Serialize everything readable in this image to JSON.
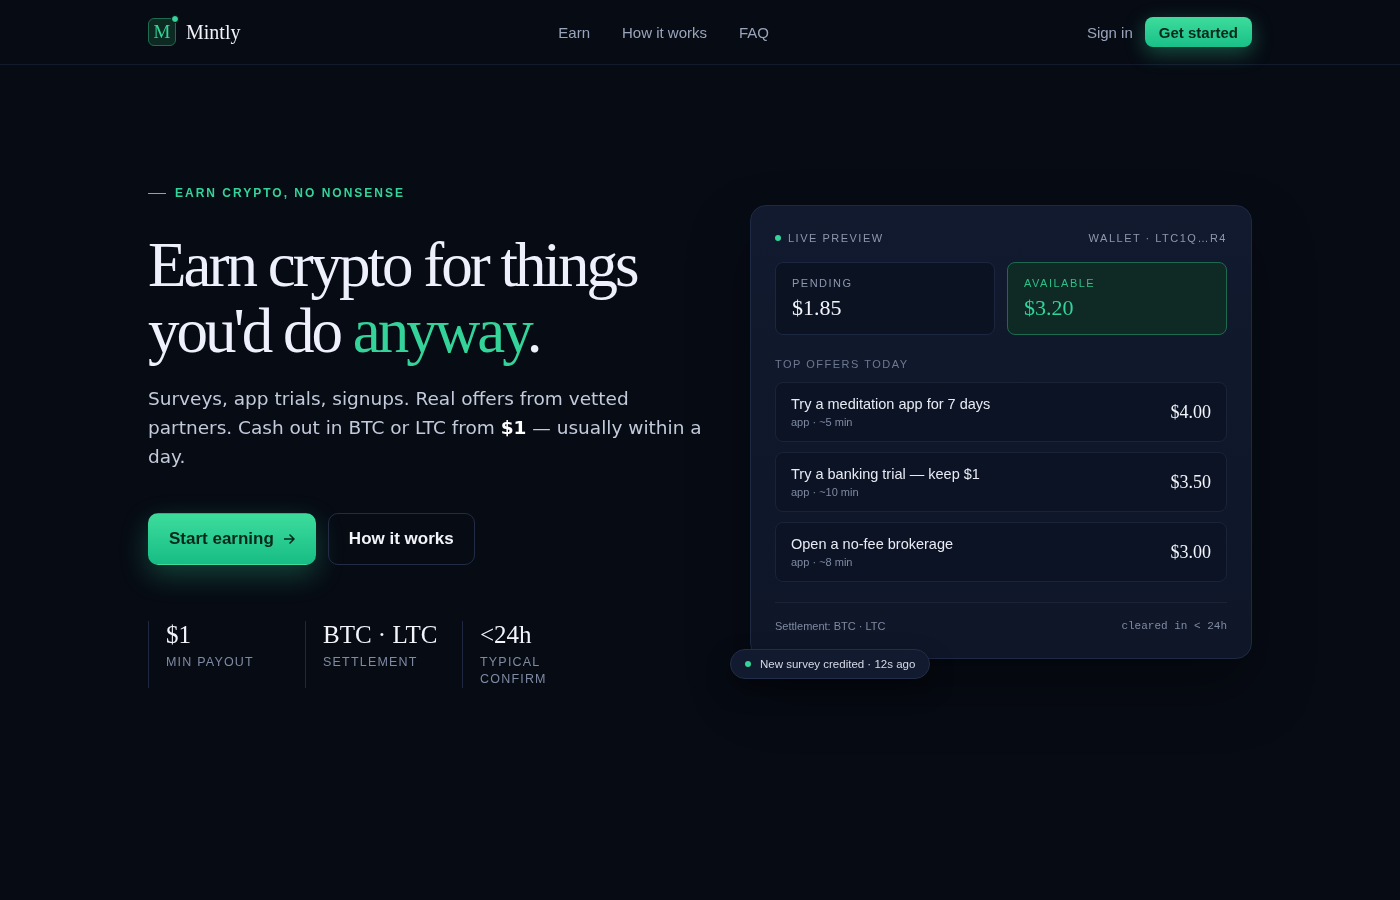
{
  "header": {
    "logo": {
      "mark": "M",
      "name": "Mintly"
    },
    "nav": [
      {
        "label": "Earn"
      },
      {
        "label": "How it works"
      },
      {
        "label": "FAQ"
      }
    ],
    "sign_in": "Sign in",
    "cta": "Get started"
  },
  "hero": {
    "eyebrow": "EARN CRYPTO, NO NONSENSE",
    "headline": {
      "lead": "Earn crypto for things you'd do",
      "accent": "anyway",
      "tail": "."
    },
    "intro": "Surveys, app trials, signups. Real offers from vetted partners. Cash out in BTC or LTC from **$1** — usually within a day.",
    "buttons": [
      {
        "label": "Start earning",
        "kind": "primary"
      },
      {
        "label": "How it works",
        "kind": "secondary"
      }
    ],
    "stats": [
      {
        "value": "$1",
        "label": "MIN PAYOUT"
      },
      {
        "value": "BTC · LTC",
        "label": "SETTLEMENT"
      },
      {
        "value": "<24h",
        "label": "TYPICAL CONFIRM"
      }
    ]
  },
  "preview": {
    "live_label": "LIVE PREVIEW",
    "wallet": "WALLET · LTC1Q…R4",
    "balances": [
      {
        "label": "PENDING",
        "amount": "$1.85",
        "highlighted": false
      },
      {
        "label": "AVAILABLE",
        "amount": "$3.20",
        "highlighted": true
      }
    ],
    "offers_title": "TOP OFFERS TODAY",
    "offers": [
      {
        "title": "Try a meditation app for 7 days",
        "meta": "app · ~5 min",
        "reward": "$4.00"
      },
      {
        "title": "Try a banking trial — keep $1",
        "meta": "app · ~10 min",
        "reward": "$3.50"
      },
      {
        "title": "Open a no-fee brokerage",
        "meta": "app · ~8 min",
        "reward": "$3.00"
      }
    ],
    "settlement": "Settlement: BTC · LTC",
    "cleared": "cleared in < 24h",
    "toast": "New survey credited · 12s ago"
  }
}
